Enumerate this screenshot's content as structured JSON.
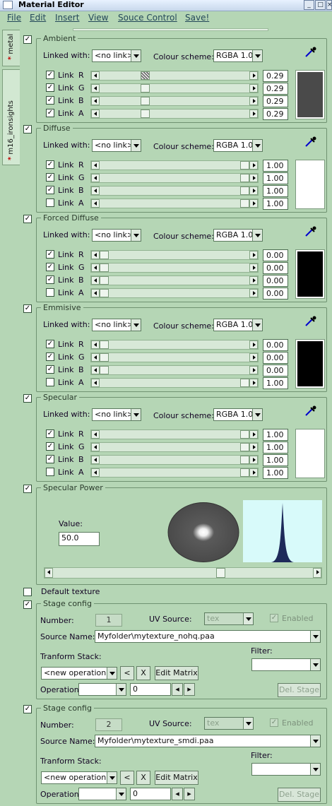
{
  "window": {
    "title": "Material  Editor",
    "controls": [
      "_",
      "□",
      "×"
    ]
  },
  "menu": [
    "File",
    "Edit",
    "Insert",
    "View",
    "Souce Control",
    "Save!"
  ],
  "side_tabs": [
    {
      "label": "metal",
      "mark": "*"
    },
    {
      "label": "m16_ironsights",
      "mark": "*"
    }
  ],
  "common": {
    "linked_with_label": "Linked with:",
    "linked_with_value": "<no link>",
    "colour_scheme_label": "Colour scheme:",
    "colour_scheme_value": "RGBA 1.0",
    "link_label": "Link",
    "channels": [
      "R",
      "G",
      "B",
      "A"
    ]
  },
  "color_sections": [
    {
      "name": "Ambient",
      "enabled": true,
      "values": [
        "0.29",
        "0.29",
        "0.29",
        "0.29"
      ],
      "levels": [
        0.29,
        0.29,
        0.29,
        0.29
      ],
      "hatch": [
        true,
        false,
        false,
        false
      ],
      "links": [
        true,
        true,
        true,
        true
      ],
      "swatch": "#4a4a4a"
    },
    {
      "name": "Diffuse",
      "enabled": true,
      "values": [
        "1.00",
        "1.00",
        "1.00",
        "1.00"
      ],
      "levels": [
        1,
        1,
        1,
        1
      ],
      "hatch": [
        false,
        false,
        false,
        false
      ],
      "links": [
        true,
        true,
        true,
        false
      ],
      "swatch": "#ffffff"
    },
    {
      "name": "Forced Diffuse",
      "enabled": true,
      "values": [
        "0.00",
        "0.00",
        "0.00",
        "0.00"
      ],
      "levels": [
        0,
        0,
        0,
        0
      ],
      "hatch": [
        false,
        false,
        false,
        false
      ],
      "links": [
        true,
        true,
        true,
        false
      ],
      "swatch": "#000000"
    },
    {
      "name": "Emmisive",
      "enabled": true,
      "values": [
        "0.00",
        "0.00",
        "0.00",
        "1.00"
      ],
      "levels": [
        0,
        0,
        0,
        1
      ],
      "hatch": [
        false,
        false,
        false,
        false
      ],
      "links": [
        true,
        true,
        true,
        false
      ],
      "swatch": "#000000"
    },
    {
      "name": "Specular",
      "enabled": true,
      "values": [
        "1.00",
        "1.00",
        "1.00",
        "1.00"
      ],
      "levels": [
        1,
        1,
        1,
        1
      ],
      "hatch": [
        false,
        false,
        false,
        false
      ],
      "links": [
        true,
        true,
        true,
        false
      ],
      "swatch": "#ffffff"
    }
  ],
  "specular_power": {
    "name": "Specular Power",
    "enabled": true,
    "value_label": "Value:",
    "value": "50.0",
    "slider_level": 0.65
  },
  "default_texture": {
    "label": "Default texture",
    "checked": false
  },
  "stages": [
    {
      "title": "Stage config",
      "enabled": true,
      "number_label": "Number:",
      "number": "1",
      "uv_source_label": "UV Source:",
      "uv_source": "tex",
      "enabled_label": "Enabled",
      "source_name_label": "Source Name:",
      "source_name": "Myfolder\\mytexture_nohq.paa",
      "transform_stack_label": "Tranform Stack:",
      "transform_op": "<new operation>",
      "back_btn": "<",
      "x_btn": "X",
      "edit_matrix": "Edit Matrix",
      "filter_label": "Filter:",
      "filter": "",
      "operation_label": "Operation",
      "operation": "",
      "operation_index": "0",
      "del_stage": "Del. Stage"
    },
    {
      "title": "Stage config",
      "enabled": true,
      "number_label": "Number:",
      "number": "2",
      "uv_source_label": "UV Source:",
      "uv_source": "tex",
      "enabled_label": "Enabled",
      "source_name_label": "Source Name:",
      "source_name": "Myfolder\\mytexture_smdi.paa",
      "transform_stack_label": "Tranform Stack:",
      "transform_op": "<new operation>",
      "back_btn": "<",
      "x_btn": "X",
      "edit_matrix": "Edit Matrix",
      "filter_label": "Filter:",
      "filter": "",
      "operation_label": "Operation",
      "operation": "",
      "operation_index": "0",
      "del_stage": "Del. Stage"
    }
  ]
}
